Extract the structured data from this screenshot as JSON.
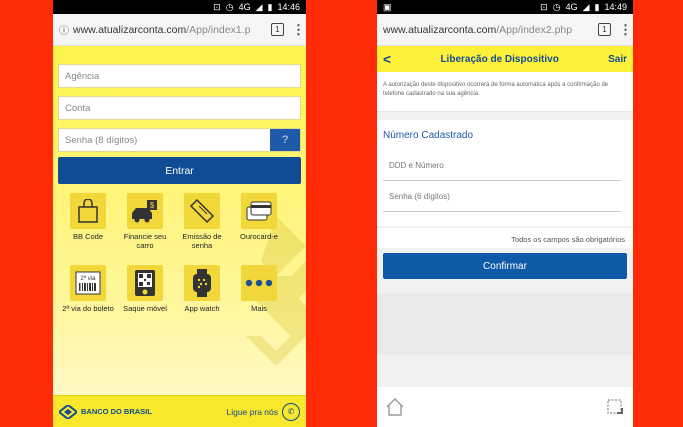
{
  "left": {
    "status": {
      "network": "4G",
      "time": "14:46"
    },
    "browser": {
      "url_main": "www.atualizarconta.com",
      "url_path": "/App/index1.p",
      "tab_count": "1"
    },
    "form": {
      "agencia_placeholder": "Agência",
      "conta_placeholder": "Conta",
      "senha_placeholder": "Senha (8 dígitos)",
      "help_label": "?",
      "submit_label": "Entrar"
    },
    "tiles": [
      {
        "label": "BB Code",
        "icon": "bag-icon"
      },
      {
        "label": "Financie seu carro",
        "icon": "car-money-icon"
      },
      {
        "label": "Emissão de senha",
        "icon": "ticket-icon"
      },
      {
        "label": "Ourocard-e",
        "icon": "cards-icon"
      },
      {
        "label": "2ª via do boleto",
        "icon": "barcode-icon"
      },
      {
        "label": "Saque móvel",
        "icon": "qr-icon"
      },
      {
        "label": "App watch",
        "icon": "watch-icon"
      },
      {
        "label": "Mais",
        "icon": "more-icon"
      }
    ],
    "tile_badge": "2ª via",
    "footer": {
      "bank_name": "BANCO DO BRASIL",
      "call_label": "Ligue pra nós"
    }
  },
  "right": {
    "status": {
      "network": "4G",
      "time": "14:49"
    },
    "browser": {
      "url_main": "www.atualizarconta.com",
      "url_path": "/App/index2.php",
      "tab_count": "1"
    },
    "header": {
      "back": "<",
      "title": "Liberação de Dispositivo",
      "exit": "Sair"
    },
    "info_text": "A autorização deste dispositivo ocorrerá de forma automática após a confirmação de telefone cadastrado na sua agência.",
    "section_title": "Número Cadastrado",
    "phone_placeholder": "DDD e Número",
    "password_placeholder": "Senha (6 dígitos)",
    "required_note": "Todos os campos são obrigatórios",
    "confirm_label": "Confirmar"
  },
  "colors": {
    "background": "#ff2b06",
    "bb_yellow": "#fff34a",
    "bb_blue": "#0f4c95"
  }
}
